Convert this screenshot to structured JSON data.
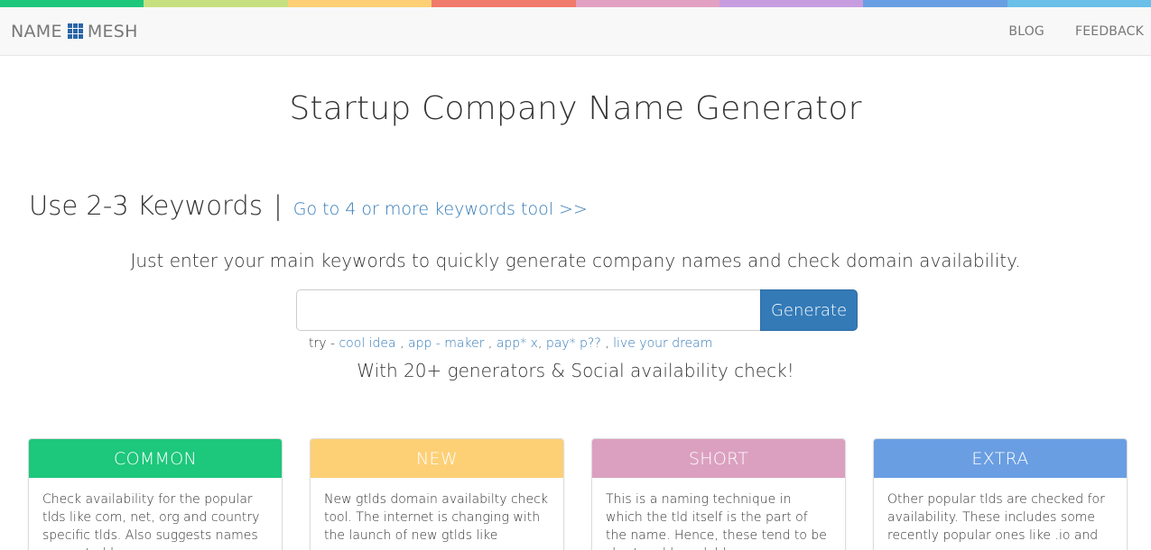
{
  "strip_colors": [
    "#1dc77c",
    "#c6e07f",
    "#fdd076",
    "#f07a6b",
    "#e2a1c2",
    "#c79ddf",
    "#6a9ee2",
    "#6ac0e8"
  ],
  "header": {
    "brand_left": "NAME",
    "brand_right": "MESH",
    "brand_icon": "grid-icon",
    "links": [
      "BLOG",
      "FEEDBACK"
    ]
  },
  "main": {
    "title": "Startup Company Name Generator",
    "kw_title": "Use 2-3 Keywords",
    "kw_sep": "|",
    "kw_link": "Go to 4 or more keywords tool >>",
    "intro": "Just enter your main keywords to quickly generate company names and check domain availability.",
    "search": {
      "value": "",
      "placeholder": ""
    },
    "generate_label": "Generate",
    "try_prefix": "try - ",
    "try_examples": [
      "cool idea",
      "app - maker",
      "app* x",
      "pay* p??",
      "live your dream"
    ],
    "social": "With 20+ generators & Social availability check!"
  },
  "cards": [
    {
      "title": "COMMON",
      "color": "#1dc77c",
      "text": "Check availability for the popular tlds like com, net, org and country specific tlds. Also suggests names separated by"
    },
    {
      "title": "NEW",
      "color": "#fdd076",
      "text": "New gtlds domain availabilty check tool. The internet is changing with the launch of new gtlds like .company,"
    },
    {
      "title": "SHORT",
      "color": "#dba0c0",
      "text": "This is a naming technique in which the tld itself is the part of the name. Hence, these tend to be short and brandable."
    },
    {
      "title": "EXTRA",
      "color": "#6a9ee2",
      "text": "Other popular tlds are checked for availability. These includes some recently popular ones like .io and .co"
    }
  ]
}
